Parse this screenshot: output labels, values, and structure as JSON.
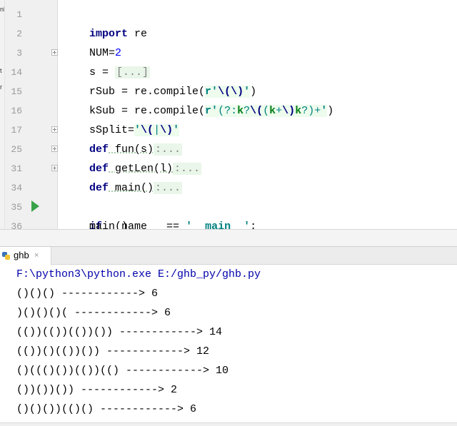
{
  "editor": {
    "left_strip_marks": [
      "nl",
      "t",
      "r"
    ],
    "line_numbers": [
      "1",
      "2",
      "3",
      "14",
      "15",
      "16",
      "17",
      "25",
      "31",
      "34",
      "35",
      "36"
    ],
    "lines": {
      "l1": {
        "kw": "import",
        "rest": " re"
      },
      "l2": {
        "name": "NUM=",
        "num": "2"
      },
      "l3": {
        "pre": "s = ",
        "collapsed": "[...]"
      },
      "l14": {
        "pre": "rSub = re.compile(",
        "str_open": "r'",
        "rx1": "\\(",
        "rx2": "\\)",
        "str_close": "'",
        "post": ")"
      },
      "l15": {
        "pre": "kSub = re.compile(",
        "str_open": "r'",
        "p1": "(?:",
        "k1": "k",
        "p2": "?",
        "e1": "\\(",
        "p3": "(",
        "k2": "k",
        "p4": "+",
        "e2": "\\)",
        "k3": "k",
        "p5": "?)+",
        "str_close": "'",
        "post": ")"
      },
      "l16": {
        "pre": "sSplit=",
        "str_open": "'",
        "e1": "\\(",
        "bar": "|",
        "e2": "\\)",
        "str_close": "'"
      },
      "l17": {
        "kw": "def",
        "name": " fun(s)",
        "collapsed": ":..."
      },
      "l25": {
        "kw": "def",
        "name": " getLen(l)",
        "collapsed": ":..."
      },
      "l31": {
        "kw": "def",
        "name": " main()",
        "collapsed": ":..."
      },
      "l34": {
        "text": ""
      },
      "l35": {
        "kw": "if",
        "pre": " __name__ == ",
        "str": "'__main__'",
        "post": ":"
      },
      "l36": {
        "text": "    main()"
      }
    }
  },
  "run_window": {
    "tab_label": "ghb",
    "close_glyph": "×",
    "command": "F:\\python3\\python.exe E:/ghb_py/ghb.py",
    "output": [
      "()()() ------------> 6",
      ")()()()( ------------> 6",
      "(())(())(())()) ------------> 14",
      "(())()(())()) ------------> 12",
      "()((()())(())(() ------------> 10",
      "())())()) ------------> 2",
      "()()())(()() ------------> 6"
    ]
  },
  "colors": {
    "keyword": "#000080",
    "number": "#0000ff",
    "string": "#008080",
    "regex_group": "#067d17",
    "gutter": "#f0f0f0",
    "run_icon": "#3aa34a"
  },
  "icons": [
    "fold-expand-icon",
    "run-icon",
    "python-file-icon",
    "close-icon"
  ]
}
